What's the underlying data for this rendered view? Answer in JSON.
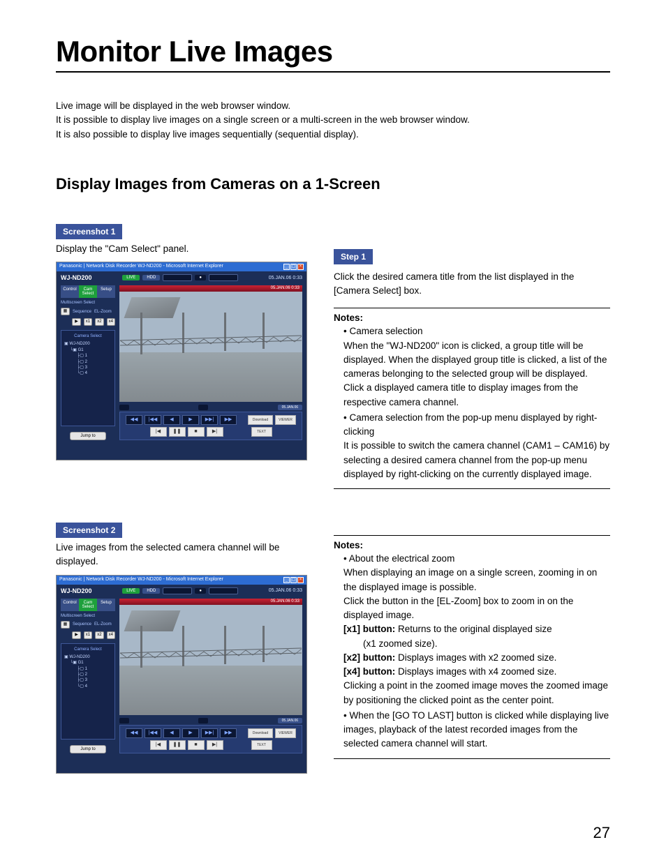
{
  "page": {
    "title": "Monitor Live Images",
    "intro1": "Live image will be displayed in the web browser window.",
    "intro2": "It is possible to display live images on a single screen or a multi-screen in the web browser window.",
    "intro3": "It is also possible to display live images sequentially (sequential display).",
    "section_title": "Display Images from Cameras on a 1-Screen",
    "number": "27"
  },
  "s1": {
    "badge": "Screenshot 1",
    "caption": "Display the \"Cam Select\" panel."
  },
  "step1": {
    "badge": "Step 1",
    "text": "Click the desired camera title from the list displayed in the [Camera Select] box."
  },
  "notes1": {
    "title": "Notes:",
    "b1_head": "Camera selection",
    "b1": "When the \"WJ-ND200\" icon is clicked, a group title will be displayed. When the displayed group title is clicked, a list of the cameras belonging to the selected group will be displayed. Click a displayed camera title to display images from the respective camera channel.",
    "b2_head": "Camera selection from the pop-up menu displayed by right-clicking",
    "b2": "It is possible to switch the camera channel (CAM1 – CAM16) by selecting a desired camera channel from the pop-up menu displayed by right-clicking on the currently displayed image."
  },
  "s2": {
    "badge": "Screenshot 2",
    "caption": "Live images from the selected camera channel will be displayed."
  },
  "notes2": {
    "title": "Notes:",
    "b1_head": "About the electrical zoom",
    "b1a": "When displaying an image on a single screen, zooming in on the displayed image is possible.",
    "b1b": "Click the button in the [EL-Zoom] box to zoom in on the displayed image.",
    "x1_label": "[x1] button:",
    "x1_text": " Returns to the original displayed size",
    "x1_text2": "(x1 zoomed size).",
    "x2_label": "[x2] button:",
    "x2_text": " Displays images with x2 zoomed size.",
    "x4_label": "[x4] button:",
    "x4_text": " Displays images with x4 zoomed size.",
    "b1c": "Clicking a point in the zoomed image moves the zoomed image by positioning the clicked point as the center point.",
    "b2": "When the [GO TO LAST] button is clicked while displaying live images, playback of the latest recorded images from the selected camera channel will start."
  },
  "app": {
    "window_title": "Panasonic | Network Disk Recorder WJ-ND200 - Microsoft Internet Explorer",
    "logo": "WJ-ND200",
    "live": "LIVE",
    "hdd": "HDD",
    "date": "05.JAN.06  0:33",
    "tab_control": "Control",
    "tab_cam": "Cam Select",
    "tab_setup": "Setup",
    "tree_head": "Camera Select",
    "tree0": "WJ-ND200",
    "tree1": "G1",
    "tree_c1": "1",
    "tree_c2": "2",
    "tree_c3": "3",
    "tree_c4": "4",
    "jump": "Jump to",
    "ms": "Multiscreen Select",
    "seq": "Sequence",
    "el": "EL-Zoom"
  }
}
